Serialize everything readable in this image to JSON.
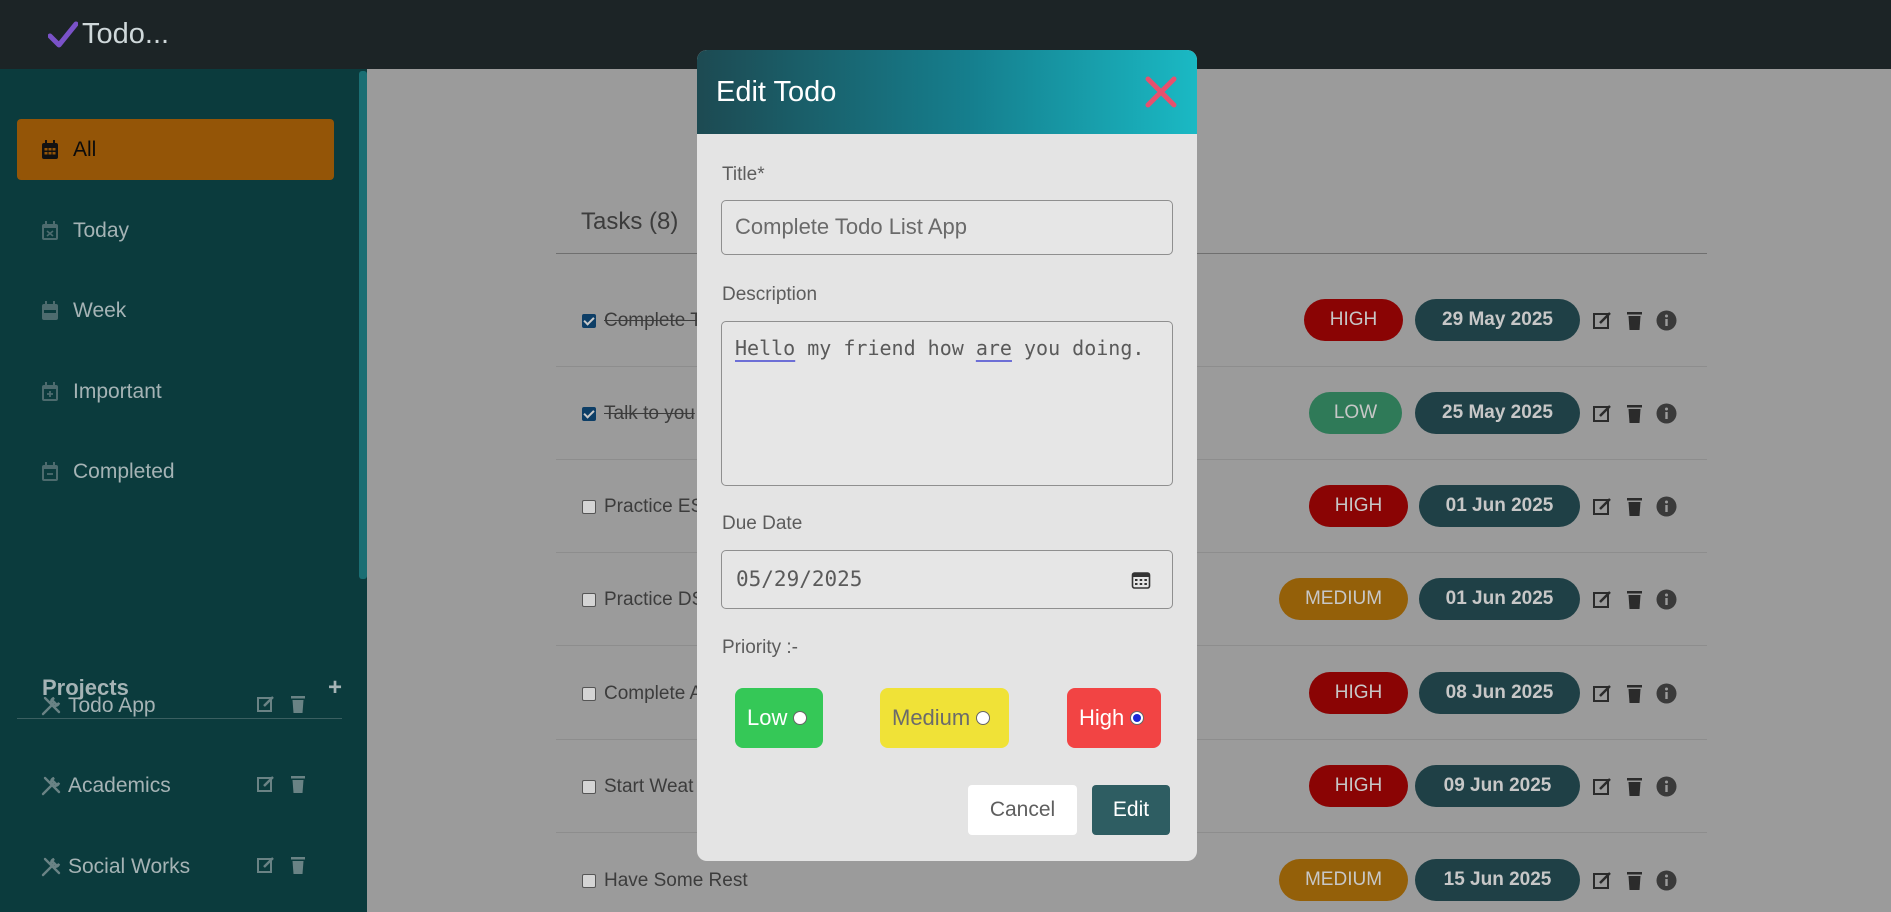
{
  "app": {
    "title": "Todo..."
  },
  "sidebar": {
    "items": [
      {
        "label": "All",
        "icon": "calendar-icon",
        "active": true
      },
      {
        "label": "Today",
        "icon": "calendar-x-icon"
      },
      {
        "label": "Week",
        "icon": "calendar-week-icon"
      },
      {
        "label": "Important",
        "icon": "calendar-plus-icon"
      },
      {
        "label": "Completed",
        "icon": "calendar-minus-icon"
      }
    ],
    "projects_title": "Projects",
    "add_label": "+",
    "projects": [
      {
        "label": "Todo App"
      },
      {
        "label": "Academics"
      },
      {
        "label": "Social Works"
      }
    ]
  },
  "main": {
    "tasks_heading": "Tasks (8)",
    "tasks": [
      {
        "title": "Complete T",
        "done": true,
        "priority": "HIGH",
        "date": "29 May 2025"
      },
      {
        "title": "Talk to you",
        "done": true,
        "priority": "LOW",
        "date": "25 May 2025"
      },
      {
        "title": "Practice ES",
        "done": false,
        "priority": "HIGH",
        "date": "01 Jun 2025"
      },
      {
        "title": "Practice DS",
        "done": false,
        "priority": "MEDIUM",
        "date": "01 Jun 2025"
      },
      {
        "title": "Complete A",
        "done": false,
        "priority": "HIGH",
        "date": "08 Jun 2025"
      },
      {
        "title": "Start Weat",
        "done": false,
        "priority": "HIGH",
        "date": "09 Jun 2025"
      },
      {
        "title": "Have Some Rest",
        "done": false,
        "priority": "MEDIUM",
        "date": "15 Jun 2025"
      }
    ]
  },
  "modal": {
    "title": "Edit Todo",
    "title_label": "Title*",
    "title_value": "Complete Todo List App",
    "description_label": "Description",
    "description_words": [
      "Hello",
      " my friend how ",
      "are",
      " you doing."
    ],
    "due_date_label": "Due Date",
    "due_date_value": "05/29/2025",
    "priority_label": "Priority :-",
    "priority_options": {
      "low": "Low",
      "medium": "Medium",
      "high": "High"
    },
    "selected_priority": "High",
    "cancel_label": "Cancel",
    "edit_label": "Edit"
  },
  "colors": {
    "accent": "#945507",
    "sidebar_bg": "#0b3b3d",
    "topbar_bg": "#1c2426",
    "high": "#8a0404",
    "low": "#2f7a58",
    "medium": "#946009",
    "date_pill": "#1f4046",
    "close": "#e8506e"
  }
}
